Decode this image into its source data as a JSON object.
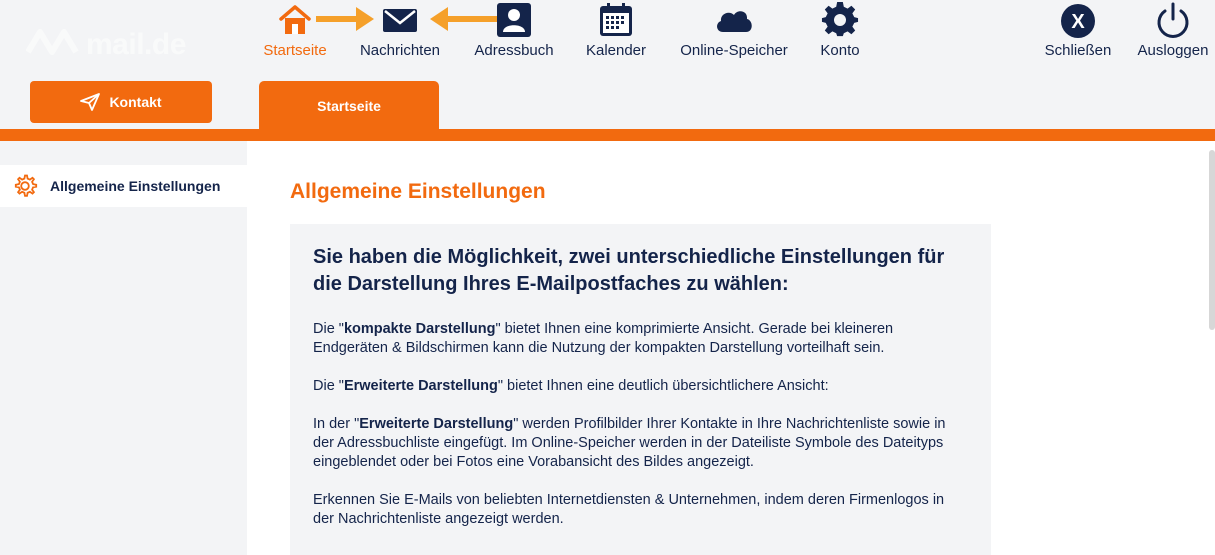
{
  "logo": {
    "text": "mail.de"
  },
  "kontakt_button": {
    "label": "Kontakt"
  },
  "nav": {
    "items": [
      {
        "id": "startseite",
        "label": "Startseite",
        "icon": "home-icon",
        "active": true
      },
      {
        "id": "nachrichten",
        "label": "Nachrichten",
        "icon": "envelope-icon"
      },
      {
        "id": "adressbuch",
        "label": "Adressbuch",
        "icon": "contact-card-icon"
      },
      {
        "id": "kalender",
        "label": "Kalender",
        "icon": "calendar-icon"
      },
      {
        "id": "online-speicher",
        "label": "Online-Speicher",
        "icon": "cloud-icon"
      },
      {
        "id": "konto",
        "label": "Konto",
        "icon": "gear-icon"
      },
      {
        "id": "schliessen",
        "label": "Schließen",
        "icon": "close-circle-icon"
      },
      {
        "id": "ausloggen",
        "label": "Ausloggen",
        "icon": "power-icon"
      }
    ]
  },
  "tab": {
    "label": "Startseite"
  },
  "sidebar": {
    "items": [
      {
        "label": "Allgemeine Einstellungen",
        "icon": "gear-outline-icon"
      }
    ]
  },
  "main": {
    "title": "Allgemeine Einstellungen",
    "box": {
      "heading": "Sie haben die Möglichkeit, zwei unterschiedliche Einstellungen für die Darstellung Ihres E-Mailpostfaches zu wählen:",
      "p1_pre": "Die \"",
      "p1_bold": "kompakte Darstellung",
      "p1_post": "\" bietet Ihnen eine komprimierte Ansicht. Gerade bei kleineren Endgeräten & Bildschirmen kann die Nutzung der kompakten Darstellung vorteilhaft sein.",
      "p2_pre": "Die \"",
      "p2_bold": "Erweiterte Darstellung",
      "p2_post": "\" bietet Ihnen eine deutlich übersichtlichere Ansicht:",
      "p3_pre": "In der \"",
      "p3_bold": "Erweiterte Darstellung",
      "p3_post": "\" werden Profilbilder Ihrer Kontakte in Ihre Nachrichtenliste sowie in der Adressbuchliste eingefügt. Im Online-Speicher werden in der Dateiliste Symbole des Dateityps eingeblendet oder bei Fotos eine Vorabansicht des Bildes angezeigt.",
      "p4": "Erkennen Sie E-Mails von beliebten Internetdiensten & Unternehmen, indem deren Firmenlogos in der Nachrichtenliste angezeigt werden."
    }
  },
  "colors": {
    "accent": "#f26a0f",
    "navy": "#14244a",
    "background": "#f3f4f6"
  }
}
